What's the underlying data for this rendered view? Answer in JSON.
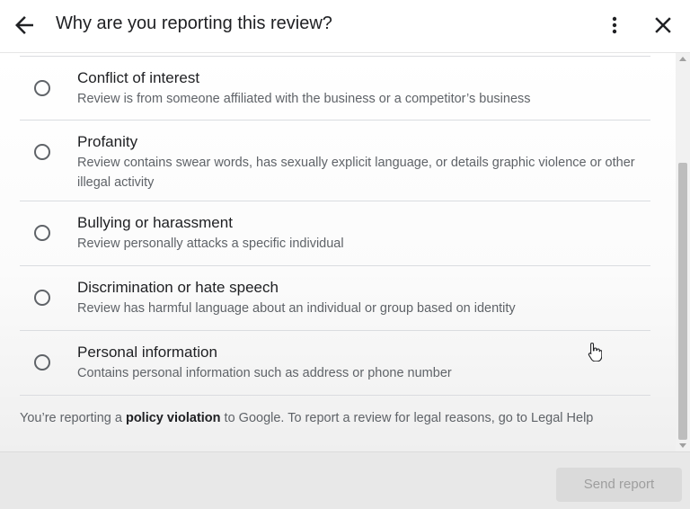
{
  "header": {
    "title": "Why are you reporting this review?"
  },
  "options": [
    {
      "title": "Conflict of interest",
      "description": "Review is from someone affiliated with the business or a competitor’s business"
    },
    {
      "title": "Profanity",
      "description": "Review contains swear words, has sexually explicit language, or details graphic violence or other illegal activity"
    },
    {
      "title": "Bullying or harassment",
      "description": "Review personally attacks a specific individual"
    },
    {
      "title": "Discrimination or hate speech",
      "description": "Review has harmful language about an individual or group based on identity"
    },
    {
      "title": "Personal information",
      "description": "Contains personal information such as address or phone number"
    }
  ],
  "footer": {
    "prefix": "You’re reporting a ",
    "emphasis": "policy violation",
    "suffix": " to Google. To report a review for legal reasons, go to Legal Help"
  },
  "actions": {
    "send_label": "Send report"
  },
  "icons": {
    "back": "arrow-back-icon",
    "more": "more-vert-icon",
    "close": "close-icon"
  },
  "colors": {
    "text": "#202124",
    "secondary": "#5f6368",
    "divider": "#dadce0"
  }
}
